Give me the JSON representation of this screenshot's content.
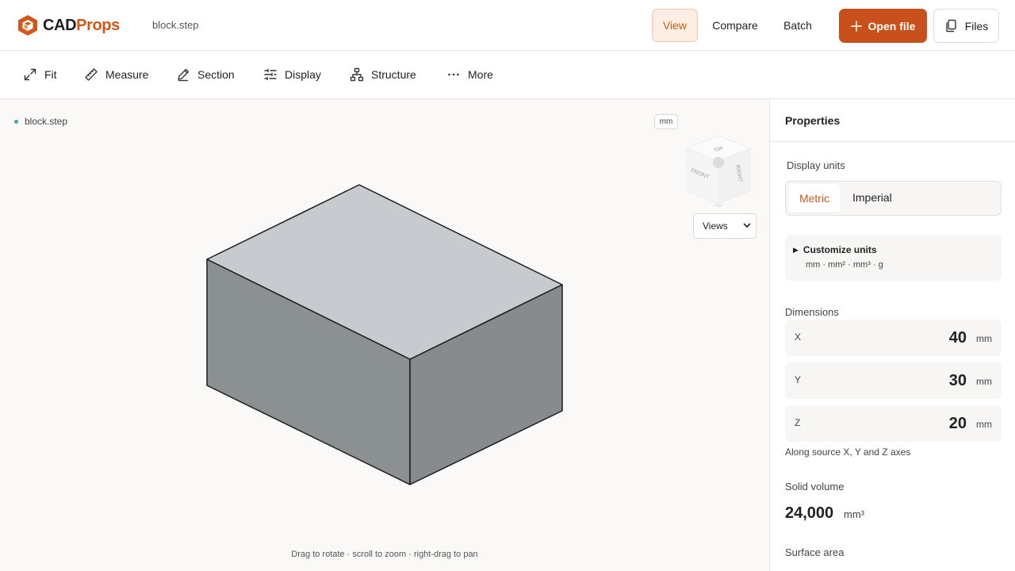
{
  "app": {
    "logo_part1": "CAD",
    "logo_part2": "Props",
    "brand_color": "#d0581a",
    "filename": "block.step"
  },
  "nav": {
    "view": "View",
    "compare": "Compare",
    "batch": "Batch",
    "open_file": "Open file",
    "files": "Files"
  },
  "toolbar": {
    "fit": "Fit",
    "measure": "Measure",
    "section": "Section",
    "display": "Display",
    "structure": "Structure",
    "more": "More"
  },
  "viewport": {
    "file_label": "block.step",
    "unit_chip": "mm",
    "views_select": "Views",
    "cube_front": "FRONT",
    "cube_right": "RIGHT",
    "cube_top": "TOP",
    "hint": "Drag to rotate · scroll to zoom · right-drag to pan"
  },
  "properties": {
    "title": "Properties",
    "display_units_label": "Display units",
    "metric": "Metric",
    "imperial": "Imperial",
    "customize_units": "Customize units",
    "units_summary": "mm · mm² · mm³ · g",
    "dimensions_label": "Dimensions",
    "dimensions": [
      {
        "axis": "X",
        "value": "40",
        "unit": "mm"
      },
      {
        "axis": "Y",
        "value": "30",
        "unit": "mm"
      },
      {
        "axis": "Z",
        "value": "20",
        "unit": "mm"
      }
    ],
    "dimensions_note": "Along source X, Y and Z axes",
    "volume_label": "Solid volume",
    "volume_value": "24,000",
    "volume_unit": "mm³",
    "surface_label": "Surface area"
  }
}
